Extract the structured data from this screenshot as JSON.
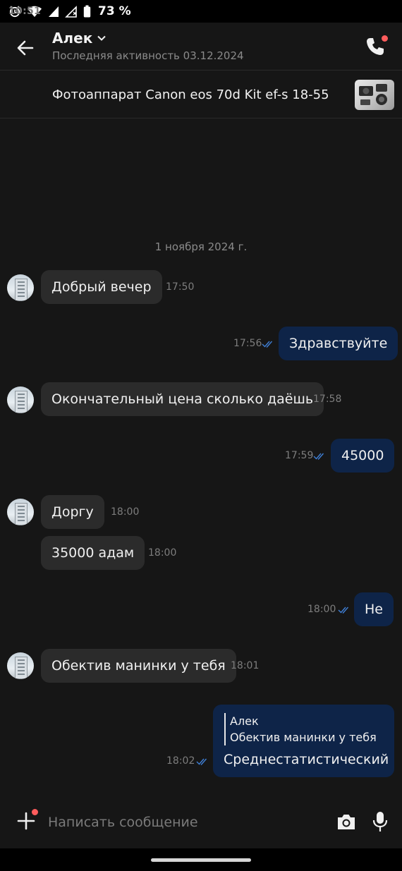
{
  "status_bar": {
    "time": "10:51",
    "battery": "73 %"
  },
  "header": {
    "contact_name": "Алек",
    "last_seen": "Последняя активность 03.12.2024"
  },
  "listing": {
    "title": "Фотоаппарат Canon eos 70d Kit ef-s 18-55"
  },
  "date_separator": "1 ноября 2024 г.",
  "messages": [
    {
      "dir": "in",
      "text": "Добрый вечер",
      "time": "17:50"
    },
    {
      "dir": "out",
      "text": "Здравствуйте",
      "time": "17:56",
      "read": true
    },
    {
      "dir": "in",
      "text": "Окончательный цена сколько даёшь",
      "time": "17:58"
    },
    {
      "dir": "out",
      "text": "45000",
      "time": "17:59",
      "read": true
    },
    {
      "dir": "in",
      "text": "Доргу",
      "time": "18:00"
    },
    {
      "dir": "in",
      "text": "35000 адам",
      "time": "18:00"
    },
    {
      "dir": "out",
      "text": "Не",
      "time": "18:00",
      "read": true
    },
    {
      "dir": "in",
      "text": "Обектив манинки у тебя",
      "time": "18:01"
    },
    {
      "dir": "out",
      "time": "18:02",
      "read": true,
      "reply_to": {
        "author": "Алек",
        "text": "Обектив манинки у тебя"
      },
      "text": "Среднестатистический"
    }
  ],
  "composer": {
    "placeholder": "Написать сообщение"
  },
  "colors": {
    "background": "#161616",
    "incoming_bubble": "#2b2b2b",
    "outgoing_bubble": "#0e2448",
    "read_ticks": "#3f7fd6",
    "notification_dot": "#ff5c5c"
  },
  "icons": {
    "back": "arrow-left-icon",
    "dropdown": "chevron-down-icon",
    "call": "phone-icon",
    "attach": "plus-icon",
    "camera": "camera-icon",
    "mic": "microphone-icon",
    "read": "double-check-icon"
  }
}
